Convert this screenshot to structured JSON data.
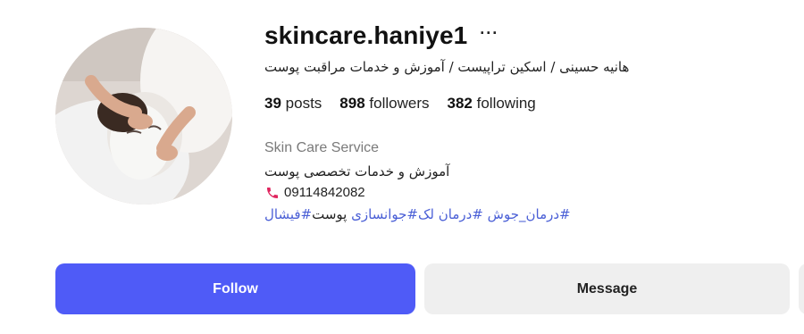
{
  "profile": {
    "username": "skincare.haniye1",
    "more_icon": "ellipsis-icon",
    "full_name": "هانیه حسینی / اسکین تراپیست / آموزش و خدمات مراقبت پوست",
    "stats": {
      "posts_count": "39",
      "posts_label": "posts",
      "followers_count": "898",
      "followers_label": "followers",
      "following_count": "382",
      "following_label": "following"
    },
    "category": "Skin Care Service",
    "bio_line": "آموزش و خدمات تخصصی پوست",
    "phone_icon": "phone-icon",
    "phone": "09114842082",
    "hashtags": {
      "t1": "#درمان_جوش",
      "t2": "#درمان لک",
      "t3": "#جوانسازی",
      "plain": " پوست",
      "t4": "#فیشال"
    }
  },
  "actions": {
    "follow_label": "Follow",
    "message_label": "Message"
  },
  "colors": {
    "follow_bg": "#4f5bf7",
    "message_bg": "#efefef",
    "hashtag": "#4a5fd6",
    "phone_icon": "#e0245e"
  }
}
